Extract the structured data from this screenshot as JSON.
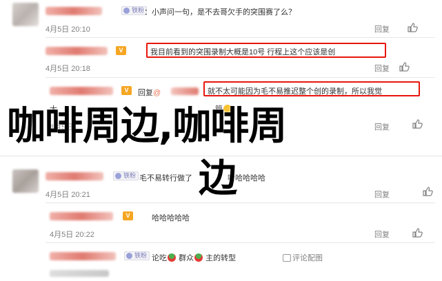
{
  "comments": [
    {
      "text_prefix": "：",
      "text": "小声问一句，是不去哥欠手的突围赛了么？",
      "time": "4月5日 20:10",
      "reply_label": "回复",
      "badge": "铁粉"
    },
    {
      "text": "我目前看到的突围录制大概是10号 行程上这个应该是创",
      "time": "4月5日 20:18",
      "reply_label": "回复"
    },
    {
      "reply_label_inline": "回复",
      "mention": "@",
      "text": "就不太可能因为毛不易推迟整个创的录制，所以我觉",
      "second_line": "大",
      "second_line_b": "管",
      "time": "4月5日",
      "reply_label": "回复"
    },
    {
      "badge": "铁粉",
      "text": "毛不易转行做了",
      "text_b": "哈哈哈哈哈",
      "time": "4月5日 20:21",
      "reply_label": "回复"
    },
    {
      "text": "哈哈哈哈哈",
      "time": "4月5日 20:22",
      "reply_label": "回复"
    },
    {
      "badge": "铁粉",
      "segments": [
        "论吃",
        "群众",
        "主的转型"
      ],
      "view_replies": "评论配图"
    }
  ],
  "watermark": {
    "line1": "咖啡周边,咖啡周",
    "line2": "边"
  },
  "colors": {
    "highlight_box": "#e8150b",
    "mention": "#eb7350",
    "time": "#808080"
  },
  "icons": {
    "like": "thumbs-up-icon",
    "vip": "vip-badge-icon",
    "fan": "fan-badge-icon"
  }
}
